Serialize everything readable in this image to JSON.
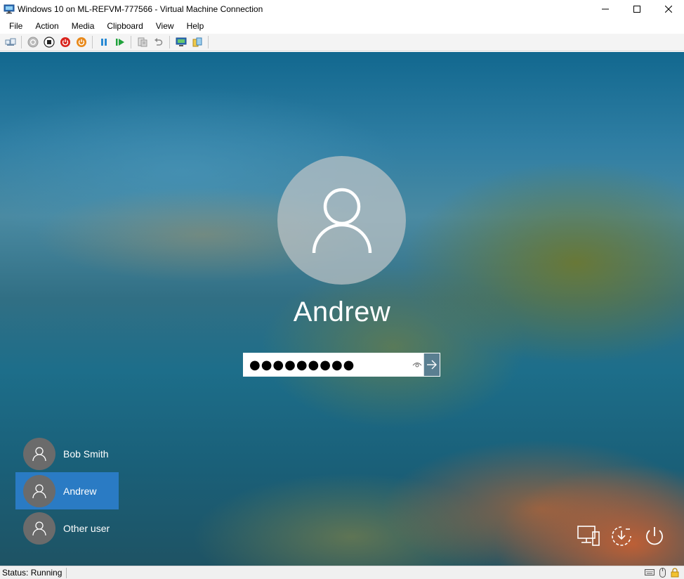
{
  "window": {
    "title": "Windows 10 on ML-REFVM-777566 - Virtual Machine Connection",
    "app_icon": "vm-monitor-icon",
    "controls": [
      "minimize-icon",
      "maximize-icon",
      "close-icon"
    ]
  },
  "menu": {
    "items": [
      {
        "label": "File"
      },
      {
        "label": "Action"
      },
      {
        "label": "Media"
      },
      {
        "label": "Clipboard"
      },
      {
        "label": "View"
      },
      {
        "label": "Help"
      }
    ]
  },
  "toolbar": {
    "buttons": [
      "ctrl-alt-del-icon",
      "start-icon",
      "turn-off-icon",
      "shut-down-icon",
      "save-state-icon",
      "pause-icon",
      "resume-icon",
      "checkpoint-icon",
      "revert-icon",
      "enhanced-session-icon",
      "share-icon"
    ],
    "colors": {
      "red": "#d9231c",
      "orange": "#e8891b",
      "blue": "#2a8ad4",
      "green": "#20a23c"
    }
  },
  "login": {
    "user_name": "Andrew",
    "password_mask": "●●●●●●●●●",
    "reveal_icon": "eye-icon",
    "submit_icon": "arrow-right-icon"
  },
  "users": [
    {
      "name": "Bob Smith",
      "selected": false
    },
    {
      "name": "Andrew",
      "selected": true
    },
    {
      "name": "Other user",
      "selected": false
    }
  ],
  "bottom_icons": [
    "network-icon",
    "ease-of-access-icon",
    "power-icon"
  ],
  "status": {
    "text": "Status: Running",
    "icons": [
      "keyboard-icon",
      "mouse-icon",
      "lock-icon"
    ]
  },
  "colors": {
    "selected_user": "#2a7bc4",
    "submit_button": "#5a7f91",
    "avatar_bg": "#6b6b6b"
  }
}
